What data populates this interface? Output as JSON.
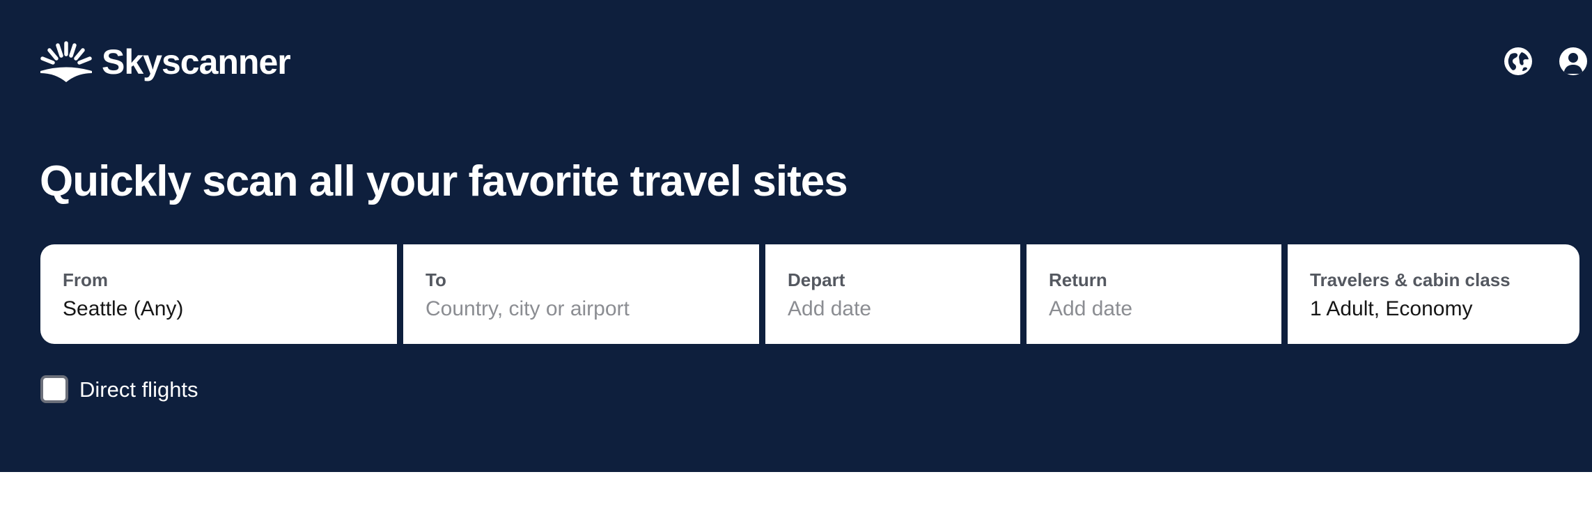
{
  "brand": {
    "name": "Skyscanner",
    "logo_icon": "sunrise-logo-icon"
  },
  "header": {
    "globe_icon": "globe-icon",
    "account_icon": "account-icon"
  },
  "hero": {
    "headline": "Quickly scan all your favorite travel sites"
  },
  "search": {
    "from": {
      "label": "From",
      "value": "Seattle (Any)"
    },
    "to": {
      "label": "To",
      "placeholder": "Country, city or airport"
    },
    "depart": {
      "label": "Depart",
      "placeholder": "Add date"
    },
    "return": {
      "label": "Return",
      "placeholder": "Add date"
    },
    "travelers": {
      "label": "Travelers & cabin class",
      "value": "1 Adult, Economy"
    }
  },
  "filters": {
    "direct_flights": {
      "label": "Direct flights",
      "checked": false
    }
  },
  "colors": {
    "hero_background": "#0e1f3d",
    "field_background": "#ffffff",
    "label_text": "#545860",
    "placeholder_text": "#8b8d92"
  }
}
